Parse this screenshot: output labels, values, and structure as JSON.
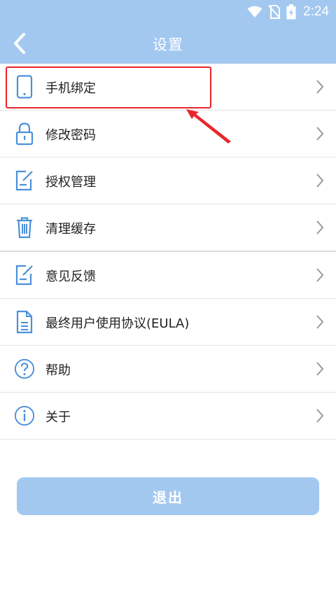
{
  "status_bar": {
    "time": "2:24",
    "icons": [
      "wifi-icon",
      "no-sim-icon",
      "battery-charging-icon"
    ]
  },
  "header": {
    "title": "设置",
    "back_icon": "back-arrow-icon"
  },
  "colors": {
    "header_bg": "#a3c8f0",
    "icon_blue": "#4a90d9",
    "highlight_red": "#e8262c",
    "text": "#222222",
    "chevron": "#9a9a9a"
  },
  "menu": {
    "items": [
      {
        "label": "手机绑定",
        "icon": "phone-icon"
      },
      {
        "label": "修改密码",
        "icon": "lock-icon"
      },
      {
        "label": "授权管理",
        "icon": "edit-note-icon"
      },
      {
        "label": "清理缓存",
        "icon": "trash-icon"
      },
      {
        "label": "意见反馈",
        "icon": "edit-note-icon"
      },
      {
        "label": "最终用户使用协议(EULA)",
        "icon": "document-icon"
      },
      {
        "label": "帮助",
        "icon": "help-icon"
      },
      {
        "label": "关于",
        "icon": "info-icon"
      }
    ]
  },
  "logout": {
    "label": "退出"
  }
}
